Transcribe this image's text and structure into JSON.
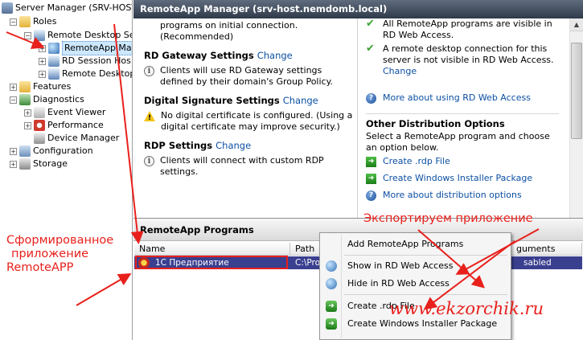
{
  "tree": {
    "header": "Server Manager (SRV-HOST",
    "items": [
      {
        "label": "Roles"
      },
      {
        "label": "Remote Desktop Se"
      },
      {
        "label": "RemoteApp Ma"
      },
      {
        "label": "RD Session Hos"
      },
      {
        "label": "Remote Desktop"
      },
      {
        "label": "Features"
      },
      {
        "label": "Diagnostics"
      },
      {
        "label": "Event Viewer"
      },
      {
        "label": "Performance"
      },
      {
        "label": "Device Manager"
      },
      {
        "label": "Configuration"
      },
      {
        "label": "Storage"
      }
    ]
  },
  "main": {
    "title": "RemoteApp Manager (srv-host.nemdomb.local)",
    "settings": {
      "top_note": "programs on initial connection.\n(Recommended)",
      "gateway": {
        "title": "RD Gateway Settings",
        "link": "Change",
        "note": "Clients will use RD Gateway settings defined by their domain's Group Policy."
      },
      "signature": {
        "title": "Digital Signature Settings",
        "link": "Change",
        "note": "No digital certificate is configured. (Using a digital certificate may improve security.)"
      },
      "rdp": {
        "title": "RDP Settings",
        "link": "Change",
        "note": "Clients will connect with custom RDP settings."
      }
    },
    "right": {
      "visible_note": "All RemoteApp programs are visible in RD Web Access.",
      "remote_note": "A remote desktop connection for this server is not visible in RD Web Access.",
      "remote_change": "Change",
      "more_web": "More about using RD Web Access",
      "other_title": "Other Distribution Options",
      "other_desc": "Select a RemoteApp program and choose an option below.",
      "create_rdp": "Create .rdp File",
      "create_msi": "Create Windows Installer Package",
      "more_dist": "More about distribution options"
    },
    "programs": {
      "header": "RemoteApp Programs",
      "columns": [
        "Name",
        "Path",
        "guments"
      ],
      "rows": [
        {
          "name": "1С Предприятие",
          "path": "C:\\Pro",
          "status": "sabled"
        }
      ]
    }
  },
  "context_menu": {
    "items": [
      "Add RemoteApp Programs",
      "Show in RD Web Access",
      "Hide in RD Web Access",
      "Create .rdp File",
      "Create Windows Installer Package"
    ]
  },
  "annotations": {
    "left_line1": "Сформированное",
    "left_line2": "приложение",
    "left_line3": "RemoteAPP",
    "export": "Экспортируем приложение",
    "site": "www.ekzorchik.ru"
  },
  "colors": {
    "accent_red": "#e8201c",
    "selection": "#3a3f8f",
    "link": "#0b4fa3"
  }
}
